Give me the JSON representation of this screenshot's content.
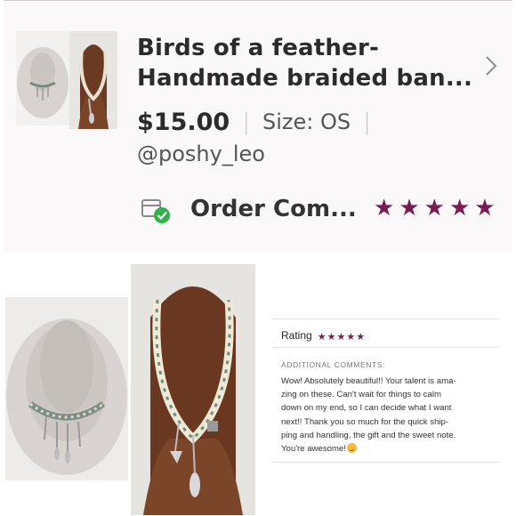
{
  "listing": {
    "title_line1": "Birds of a feather-",
    "title_line2": "Handmade braided ban...",
    "price": "$15.00",
    "size": "Size: OS",
    "seller": "@poshy_leo",
    "order_status": "Order Com...",
    "rating_stars": 5
  },
  "review": {
    "rating_label": "Rating",
    "rating_stars": 5,
    "comments_heading": "ADDITIONAL COMMENTS:",
    "comment_lines": [
      "Wow! Absolutely beautiful!! Your talent is ama-",
      "zing on these. Can't wait for things to calm",
      "down on my end, so I can decide what I want",
      "next!! Thank you so much for the quick ship-",
      "ping and handling, the gift and the sweet note.",
      "You're awesome!"
    ]
  },
  "icons": {
    "chevron": "chevron-right-icon",
    "order": "package-check-icon",
    "star": "star-icon",
    "emoji": "grinning-face-icon"
  },
  "colors": {
    "star": "#7a1c4f",
    "check": "#2db34a",
    "card_bg": "#fbf8f9"
  }
}
